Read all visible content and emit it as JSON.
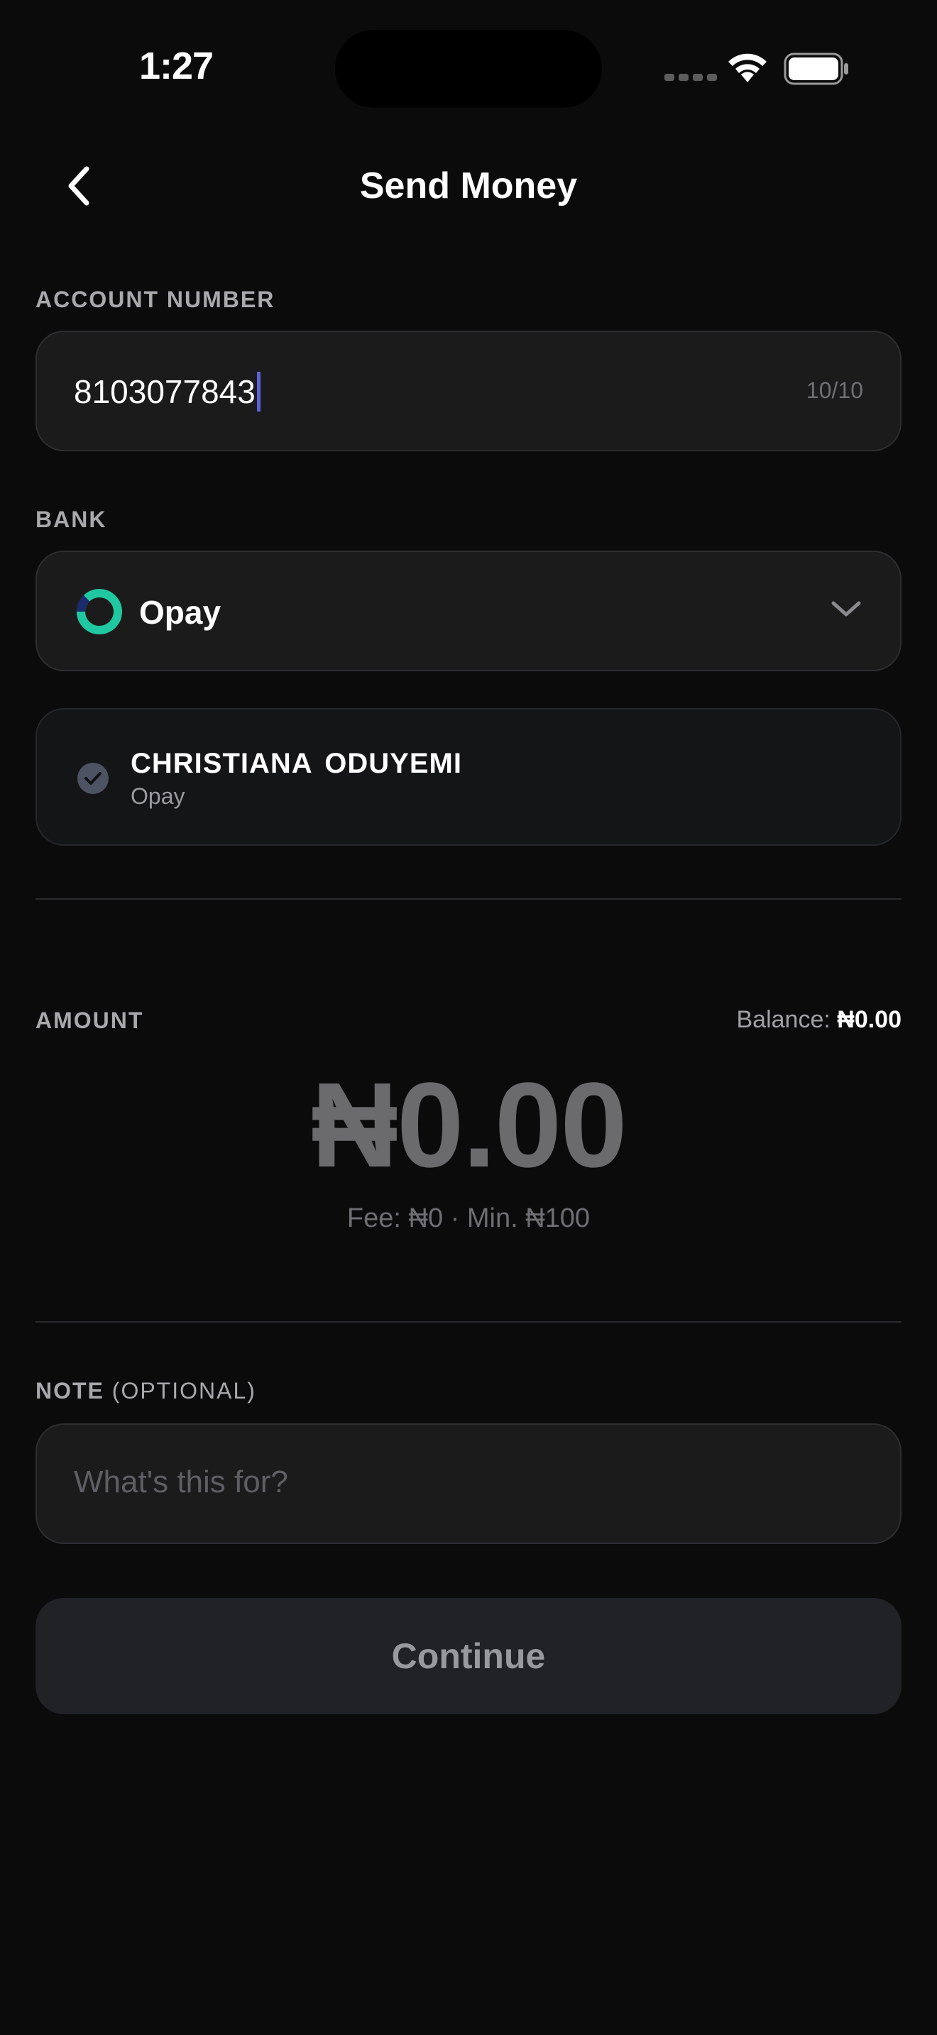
{
  "status_bar": {
    "time": "1:27"
  },
  "header": {
    "title": "Send Money"
  },
  "account": {
    "label": "ACCOUNT NUMBER",
    "value": "8103077843",
    "counter": "10/10"
  },
  "bank": {
    "label": "BANK",
    "selected": "Opay",
    "logo_icon": "opay-logo-icon",
    "logo_color": "#1fc8a0"
  },
  "recipient": {
    "name": "CHRISTIANA  ODUYEMI",
    "bank": "Opay"
  },
  "amount": {
    "label": "AMOUNT",
    "balance_label": "Balance:",
    "balance_value": "₦0.00",
    "display": "₦0.00",
    "fee_line": "Fee: ₦0 · Min. ₦100"
  },
  "note": {
    "label": "NOTE",
    "optional": "(OPTIONAL)",
    "placeholder": "What's this for?"
  },
  "actions": {
    "continue_label": "Continue"
  },
  "colors": {
    "background": "#0b0b0c",
    "field": "#1b1b1c",
    "caret": "#5a62d8",
    "button": "#202226"
  }
}
